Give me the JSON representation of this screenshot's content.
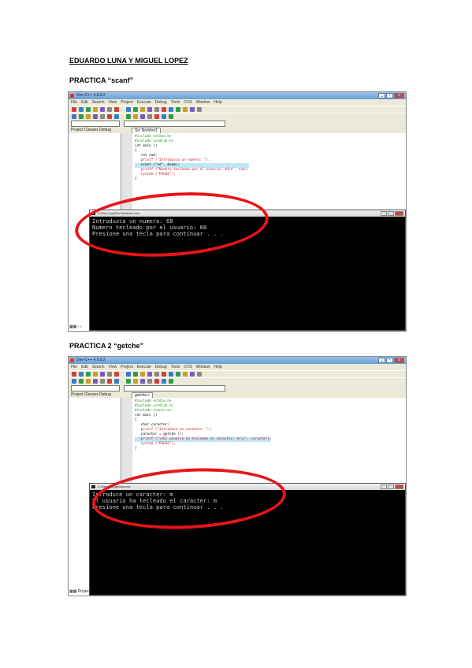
{
  "document": {
    "authors": "EDUARDO LUNA Y MIGUEL LOPEZ",
    "practice1_heading": "PRACTICA “scanf”",
    "practice2_heading": "PRACTICA 2 “getche”"
  },
  "screenshot1": {
    "window_title": "Dev-C++ 4.9.9.2",
    "menu": [
      "File",
      "Edit",
      "Search",
      "View",
      "Project",
      "Execute",
      "Debug",
      "Tools",
      "CVS",
      "Window",
      "Help"
    ],
    "tabs": {
      "project": "Project Classes Debug",
      "file": "Sin Nombre1"
    },
    "code": [
      {
        "text": "#include <stdio.h>",
        "color": "#1a8a1a",
        "hl": false
      },
      {
        "text": "#include <stdlib.h>",
        "color": "#1a8a1a",
        "hl": false
      },
      {
        "text": "int main ()",
        "color": "#000000",
        "hl": false
      },
      {
        "text": "{",
        "color": "#000000",
        "hl": false
      },
      {
        "text": "   int num;",
        "color": "#000000",
        "hl": false
      },
      {
        "text": "   printf (\"Introduzca un numero: \");",
        "color": "#c0162a",
        "hl": false
      },
      {
        "text": "   scanf (\"%d\", &num);",
        "color": "#000000",
        "hl": true
      },
      {
        "text": "   printf (\"Numero tecleado por el usuario: %d\\n\", num);",
        "color": "#c0162a",
        "hl": false
      },
      {
        "text": "   system (\"PAUSE\");",
        "color": "#c0162a",
        "hl": false
      },
      {
        "text": "}",
        "color": "#000000",
        "hl": false
      }
    ],
    "console_title": "C:\\Dev-Cpp\\Sin Nombre1.exe",
    "console_lines": [
      "Introduzca un numero: 68",
      "Numero tecleado por el usuario: 68",
      "Presione una tecla para continuar . . ."
    ],
    "left_bottom": "▦▦ ‹ ›"
  },
  "screenshot2": {
    "window_title": "Dev-C++ 4.9.9.2",
    "menu": [
      "File",
      "Edit",
      "Search",
      "View",
      "Project",
      "Execute",
      "Debug",
      "Tools",
      "CVS",
      "Window",
      "Help"
    ],
    "tabs": {
      "project": "Project Classes Debug",
      "file": "getche.c"
    },
    "code": [
      {
        "text": "#include <stdio.h>",
        "color": "#1a8a1a",
        "hl": false
      },
      {
        "text": "#include <stdlib.h>",
        "color": "#1a8a1a",
        "hl": false
      },
      {
        "text": "#include <conio.h>",
        "color": "#1a8a1a",
        "hl": false
      },
      {
        "text": "int main ()",
        "color": "#000000",
        "hl": false
      },
      {
        "text": "{",
        "color": "#000000",
        "hl": false
      },
      {
        "text": "   char caracter;",
        "color": "#000000",
        "hl": false
      },
      {
        "text": "   printf (\"Introduce un caracter: \");",
        "color": "#c0162a",
        "hl": false
      },
      {
        "text": "   caracter = getche ();",
        "color": "#000000",
        "hl": false
      },
      {
        "text": "   printf (\"\\nEl usuario ha tecleado el caracter: %c\\n\", caracter);",
        "color": "#c0162a",
        "hl": true
      },
      {
        "text": "   system (\"PAUSE\");",
        "color": "#c0162a",
        "hl": false
      },
      {
        "text": "}",
        "color": "#000000",
        "hl": false
      }
    ],
    "console_title": "C:\\Dev-Cpp\\getche.exe",
    "console_lines": [
      "Introduce un caracter: m",
      "El usuario ha tecleado el caracter: m",
      "Presione una tecla para continuar . . ."
    ],
    "left_bottom": "▦▦ Project"
  },
  "colors": {
    "annotation_ring": "#e8141a",
    "console_bg": "#000000",
    "console_text": "#cfcfcf"
  }
}
